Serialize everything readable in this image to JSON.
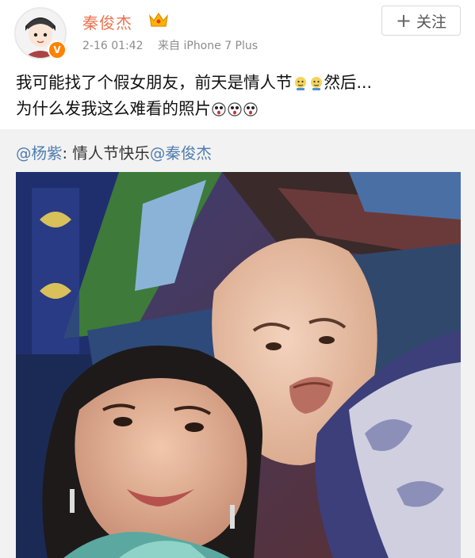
{
  "header": {
    "username": "秦俊杰",
    "verified_badge": "V",
    "timestamp": "2-16 01:42",
    "source": "来自 iPhone 7 Plus",
    "follow_plus": "+",
    "follow_label": "关注"
  },
  "post": {
    "line1": "我可能找了个假女朋友，前天是情人节",
    "line1_end": "然后...",
    "line2": "为什么发我这么难看的照片",
    "emoji_names": [
      "doge-emoji",
      "doge-emoji",
      "shocked-emoji",
      "shocked-emoji",
      "shocked-emoji"
    ]
  },
  "repost": {
    "author": "@杨紫",
    "colon": ": ",
    "text": "情人节快乐",
    "mention": "@秦俊杰"
  },
  "colors": {
    "username": "#eb7350",
    "mention": "#507daf",
    "badge": "#ff8200",
    "repost_bg": "#f2f2f2"
  }
}
